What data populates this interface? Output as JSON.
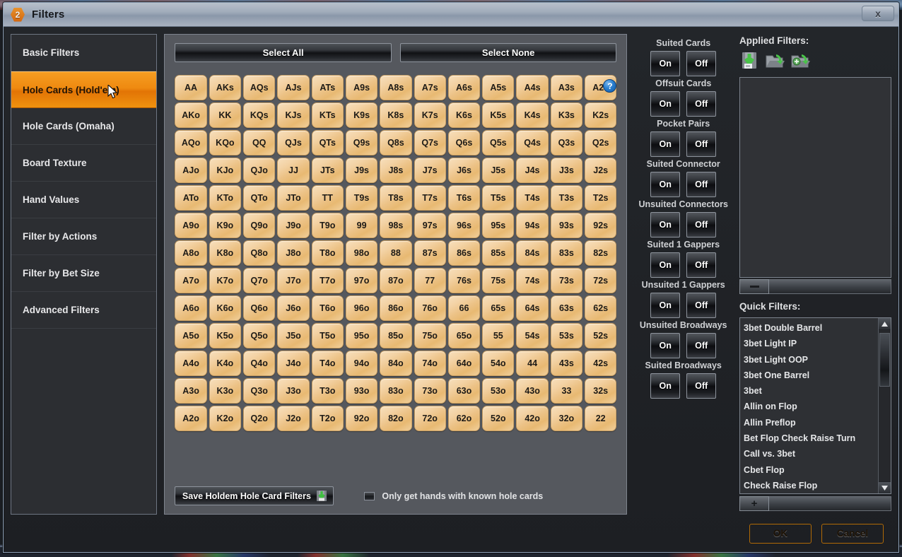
{
  "window": {
    "badge": "2",
    "title": "Filters",
    "close_label": "x"
  },
  "sidebar": {
    "items": [
      {
        "label": "Basic Filters",
        "selected": false
      },
      {
        "label": "Hole Cards (Hold'em)",
        "selected": true
      },
      {
        "label": "Hole Cards (Omaha)",
        "selected": false
      },
      {
        "label": "Board Texture",
        "selected": false
      },
      {
        "label": "Hand Values",
        "selected": false
      },
      {
        "label": "Filter by Actions",
        "selected": false
      },
      {
        "label": "Filter by Bet Size",
        "selected": false
      },
      {
        "label": "Advanced Filters",
        "selected": false
      }
    ]
  },
  "grid_panel": {
    "select_all_label": "Select All",
    "select_none_label": "Select None",
    "help_label": "?",
    "save_button_label": "Save Holdem Hole Card Filters",
    "checkbox_label": "Only get hands with known hole cards",
    "checkbox_checked": false,
    "rows": [
      [
        "AA",
        "AKs",
        "AQs",
        "AJs",
        "ATs",
        "A9s",
        "A8s",
        "A7s",
        "A6s",
        "A5s",
        "A4s",
        "A3s",
        "A2s"
      ],
      [
        "AKo",
        "KK",
        "KQs",
        "KJs",
        "KTs",
        "K9s",
        "K8s",
        "K7s",
        "K6s",
        "K5s",
        "K4s",
        "K3s",
        "K2s"
      ],
      [
        "AQo",
        "KQo",
        "QQ",
        "QJs",
        "QTs",
        "Q9s",
        "Q8s",
        "Q7s",
        "Q6s",
        "Q5s",
        "Q4s",
        "Q3s",
        "Q2s"
      ],
      [
        "AJo",
        "KJo",
        "QJo",
        "JJ",
        "JTs",
        "J9s",
        "J8s",
        "J7s",
        "J6s",
        "J5s",
        "J4s",
        "J3s",
        "J2s"
      ],
      [
        "ATo",
        "KTo",
        "QTo",
        "JTo",
        "TT",
        "T9s",
        "T8s",
        "T7s",
        "T6s",
        "T5s",
        "T4s",
        "T3s",
        "T2s"
      ],
      [
        "A9o",
        "K9o",
        "Q9o",
        "J9o",
        "T9o",
        "99",
        "98s",
        "97s",
        "96s",
        "95s",
        "94s",
        "93s",
        "92s"
      ],
      [
        "A8o",
        "K8o",
        "Q8o",
        "J8o",
        "T8o",
        "98o",
        "88",
        "87s",
        "86s",
        "85s",
        "84s",
        "83s",
        "82s"
      ],
      [
        "A7o",
        "K7o",
        "Q7o",
        "J7o",
        "T7o",
        "97o",
        "87o",
        "77",
        "76s",
        "75s",
        "74s",
        "73s",
        "72s"
      ],
      [
        "A6o",
        "K6o",
        "Q6o",
        "J6o",
        "T6o",
        "96o",
        "86o",
        "76o",
        "66",
        "65s",
        "64s",
        "63s",
        "62s"
      ],
      [
        "A5o",
        "K5o",
        "Q5o",
        "J5o",
        "T5o",
        "95o",
        "85o",
        "75o",
        "65o",
        "55",
        "54s",
        "53s",
        "52s"
      ],
      [
        "A4o",
        "K4o",
        "Q4o",
        "J4o",
        "T4o",
        "94o",
        "84o",
        "74o",
        "64o",
        "54o",
        "44",
        "43s",
        "42s"
      ],
      [
        "A3o",
        "K3o",
        "Q3o",
        "J3o",
        "T3o",
        "93o",
        "83o",
        "73o",
        "63o",
        "53o",
        "43o",
        "33",
        "32s"
      ],
      [
        "A2o",
        "K2o",
        "Q2o",
        "J2o",
        "T2o",
        "92o",
        "82o",
        "72o",
        "62o",
        "52o",
        "42o",
        "32o",
        "22"
      ]
    ]
  },
  "toggles": {
    "on_label": "On",
    "off_label": "Off",
    "groups": [
      {
        "label": "Suited Cards"
      },
      {
        "label": "Offsuit Cards"
      },
      {
        "label": "Pocket Pairs"
      },
      {
        "label": "Suited Connector"
      },
      {
        "label": "Unsuited Connectors"
      },
      {
        "label": "Suited 1 Gappers"
      },
      {
        "label": "Unsuited 1 Gappers"
      },
      {
        "label": "Unsuited Broadways"
      },
      {
        "label": "Suited Broadways"
      }
    ]
  },
  "right_panel": {
    "applied_title": "Applied Filters:",
    "applied_items": [],
    "icons": [
      "save-filter-icon",
      "open-filter-icon",
      "add-filter-icon"
    ],
    "remove_label": "-",
    "quick_title": "Quick Filters:",
    "add_label": "+",
    "quick_filters": [
      "3bet Double Barrel",
      "3bet Light IP",
      "3bet Light OOP",
      "3bet One Barrel",
      "3bet",
      "Allin on Flop",
      "Allin Preflop",
      "Bet Flop Check Raise Turn",
      "Call vs. 3bet",
      "Cbet Flop",
      "Check Raise Flop"
    ]
  },
  "footer": {
    "ok_label": "OK",
    "cancel_label": "Cancel"
  },
  "colors": {
    "accent_orange": "#f0941b",
    "card_tan": "#ecc286",
    "panel_gray": "#55585e",
    "help_blue": "#2a7fd0"
  }
}
